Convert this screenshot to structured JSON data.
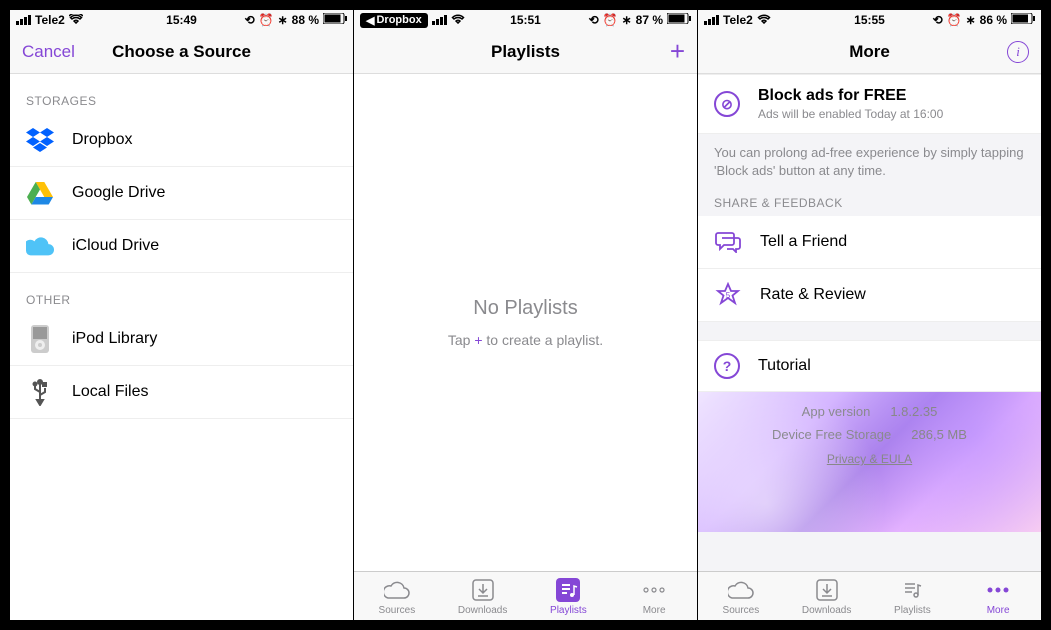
{
  "accent": "#8547d6",
  "screens": {
    "s1": {
      "status": {
        "carrier": "Tele2",
        "time": "15:49",
        "battery": "88 %"
      },
      "nav": {
        "left": "Cancel",
        "title": "Choose a Source"
      },
      "sections": [
        {
          "header": "STORAGES",
          "items": [
            {
              "icon": "dropbox-icon",
              "label": "Dropbox"
            },
            {
              "icon": "google-drive-icon",
              "label": "Google Drive"
            },
            {
              "icon": "icloud-icon",
              "label": "iCloud Drive"
            }
          ]
        },
        {
          "header": "OTHER",
          "items": [
            {
              "icon": "ipod-icon",
              "label": "iPod Library"
            },
            {
              "icon": "usb-icon",
              "label": "Local Files"
            }
          ]
        }
      ]
    },
    "s2": {
      "status": {
        "back": "Dropbox",
        "time": "15:51",
        "battery": "87 %"
      },
      "nav": {
        "title": "Playlists",
        "right": "+"
      },
      "empty": {
        "title": "No Playlists",
        "pre": "Tap ",
        "plus": "+",
        "post": " to create a playlist."
      },
      "tabs": [
        {
          "icon": "cloud-icon",
          "label": "Sources"
        },
        {
          "icon": "download-icon",
          "label": "Downloads"
        },
        {
          "icon": "playlist-icon",
          "label": "Playlists",
          "active": true
        },
        {
          "icon": "more-icon",
          "label": "More"
        }
      ]
    },
    "s3": {
      "status": {
        "carrier": "Tele2",
        "time": "15:55",
        "battery": "86 %"
      },
      "nav": {
        "title": "More",
        "right": "info"
      },
      "block_ads": {
        "title": "Block ads for FREE",
        "sub": "Ads will be enabled Today at 16:00"
      },
      "prolong": "You can prolong ad-free experience by simply tapping 'Block ads' button at any time.",
      "feedback_header": "SHARE & FEEDBACK",
      "items": [
        {
          "icon": "chat-icon",
          "label": "Tell a Friend"
        },
        {
          "icon": "star-icon",
          "label": "Rate & Review"
        },
        {
          "icon": "question-icon",
          "label": "Tutorial"
        }
      ],
      "meta": {
        "version_label": "App version",
        "version": "1.8.2.35",
        "storage_label": "Device Free Storage",
        "storage": "286,5 MB",
        "privacy": "Privacy & EULA"
      },
      "tabs": [
        {
          "icon": "cloud-icon",
          "label": "Sources"
        },
        {
          "icon": "download-icon",
          "label": "Downloads"
        },
        {
          "icon": "playlist-icon",
          "label": "Playlists"
        },
        {
          "icon": "more-icon",
          "label": "More",
          "active": true
        }
      ]
    }
  }
}
